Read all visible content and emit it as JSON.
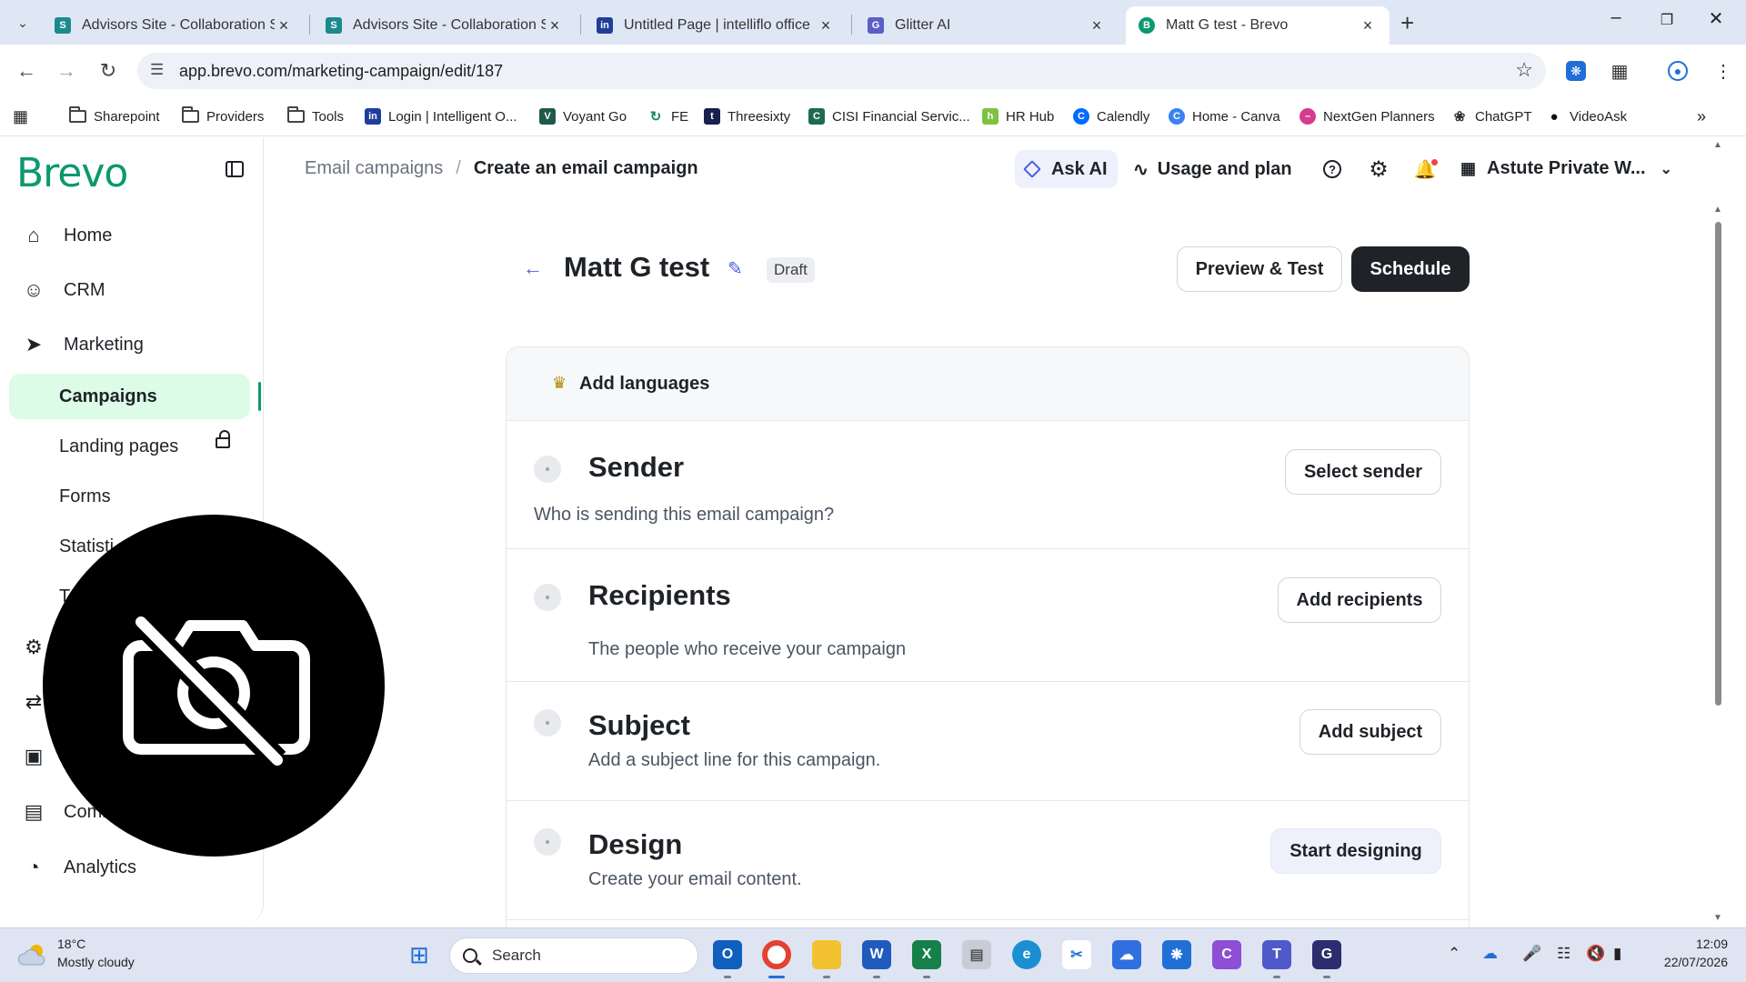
{
  "browser": {
    "tabs": [
      {
        "title": "Advisors Site - Collaboration Sit",
        "favicon_color": "#1b8a8f"
      },
      {
        "title": "Advisors Site - Collaboration Sit",
        "favicon_color": "#1b8a8f"
      },
      {
        "title": "Untitled Page | intelliflo office",
        "favicon_color": "#1f3d9b",
        "favicon_text": "in"
      },
      {
        "title": "Glitter AI",
        "favicon_color": "#5b5fc7",
        "favicon_text": "G"
      },
      {
        "title": "Matt G test - Brevo",
        "favicon_color": "#0b996e",
        "favicon_text": "B",
        "active": true
      }
    ],
    "url": "app.brevo.com/marketing-campaign/edit/187",
    "bookmarks": [
      {
        "label": "Sharepoint",
        "icon": "folder-icon"
      },
      {
        "label": "Providers",
        "icon": "folder-icon"
      },
      {
        "label": "Tools",
        "icon": "folder-icon"
      },
      {
        "label": "Login | Intelligent O...",
        "icon": "intelliflo-icon"
      },
      {
        "label": "Voyant Go",
        "icon": "voyant-icon"
      },
      {
        "label": "FE",
        "icon": "fe-icon"
      },
      {
        "label": "Threesixty",
        "icon": "threesixty-icon"
      },
      {
        "label": "CISI Financial Servic...",
        "icon": "cisi-icon"
      },
      {
        "label": "HR Hub",
        "icon": "hrhub-icon"
      },
      {
        "label": "Calendly",
        "icon": "calendly-icon"
      },
      {
        "label": "Home - Canva",
        "icon": "canva-icon"
      },
      {
        "label": "NextGen Planners",
        "icon": "nextgen-icon"
      },
      {
        "label": "ChatGPT",
        "icon": "chatgpt-icon"
      },
      {
        "label": "VideoAsk",
        "icon": "videoask-icon"
      }
    ]
  },
  "sidebar": {
    "logo": "Brevo",
    "items": [
      {
        "label": "Home",
        "icon": "home-icon"
      },
      {
        "label": "CRM",
        "icon": "contacts-icon"
      },
      {
        "label": "Marketing",
        "icon": "send-icon"
      }
    ],
    "sub_items": [
      {
        "label": "Campaigns",
        "active": true
      },
      {
        "label": "Landing pages",
        "locked": true
      },
      {
        "label": "Forms"
      },
      {
        "label": "Statisti"
      },
      {
        "label": "T"
      }
    ],
    "lower_items": [
      {
        "label": "Comm",
        "icon": "bag-icon"
      },
      {
        "label": "Analytics",
        "icon": "pie-chart-icon"
      }
    ]
  },
  "header": {
    "breadcrumb_parent": "Email campaigns",
    "breadcrumb_sep": "/",
    "breadcrumb_current": "Create an email campaign",
    "ask_ai": "Ask AI",
    "usage": "Usage and plan",
    "account": "Astute Private W..."
  },
  "campaign": {
    "name": "Matt G test",
    "status": "Draft",
    "preview_label": "Preview & Test",
    "schedule_label": "Schedule",
    "add_languages": "Add languages",
    "steps": [
      {
        "title": "Sender",
        "description": "Who is sending this email campaign?",
        "button": "Select sender"
      },
      {
        "title": "Recipients",
        "description": "The people who receive your campaign",
        "button": "Add recipients"
      },
      {
        "title": "Subject",
        "description": "Add a subject line for this campaign.",
        "button": "Add subject"
      },
      {
        "title": "Design",
        "description": "Create your email content.",
        "button": "Start designing"
      }
    ]
  },
  "taskbar": {
    "weather_temp": "18°C",
    "weather_desc": "Mostly cloudy",
    "search_placeholder": "Search",
    "time": "12:09",
    "date": "22/07/2026"
  }
}
